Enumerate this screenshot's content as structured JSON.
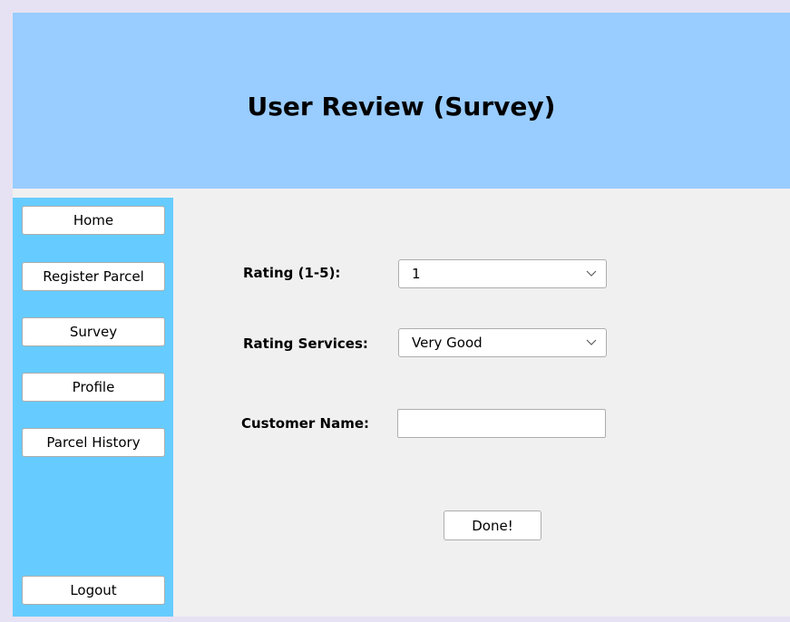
{
  "header": {
    "title": "User Review (Survey)"
  },
  "sidebar": {
    "items": [
      {
        "label": "Home"
      },
      {
        "label": "Register Parcel"
      },
      {
        "label": "Survey"
      },
      {
        "label": "Profile"
      },
      {
        "label": "Parcel History"
      }
    ],
    "logout_label": "Logout"
  },
  "form": {
    "rating": {
      "label": "Rating (1-5):",
      "value": "1"
    },
    "rating_services": {
      "label": "Rating Services:",
      "value": "Very Good"
    },
    "customer_name": {
      "label": "Customer Name:",
      "value": ""
    },
    "done_label": "Done!"
  },
  "colors": {
    "header_bg": "#99ccff",
    "sidebar_bg": "#66ccff",
    "content_bg": "#f0f0f0"
  },
  "icons": {
    "combo_arrow": "chevron-down-icon"
  }
}
